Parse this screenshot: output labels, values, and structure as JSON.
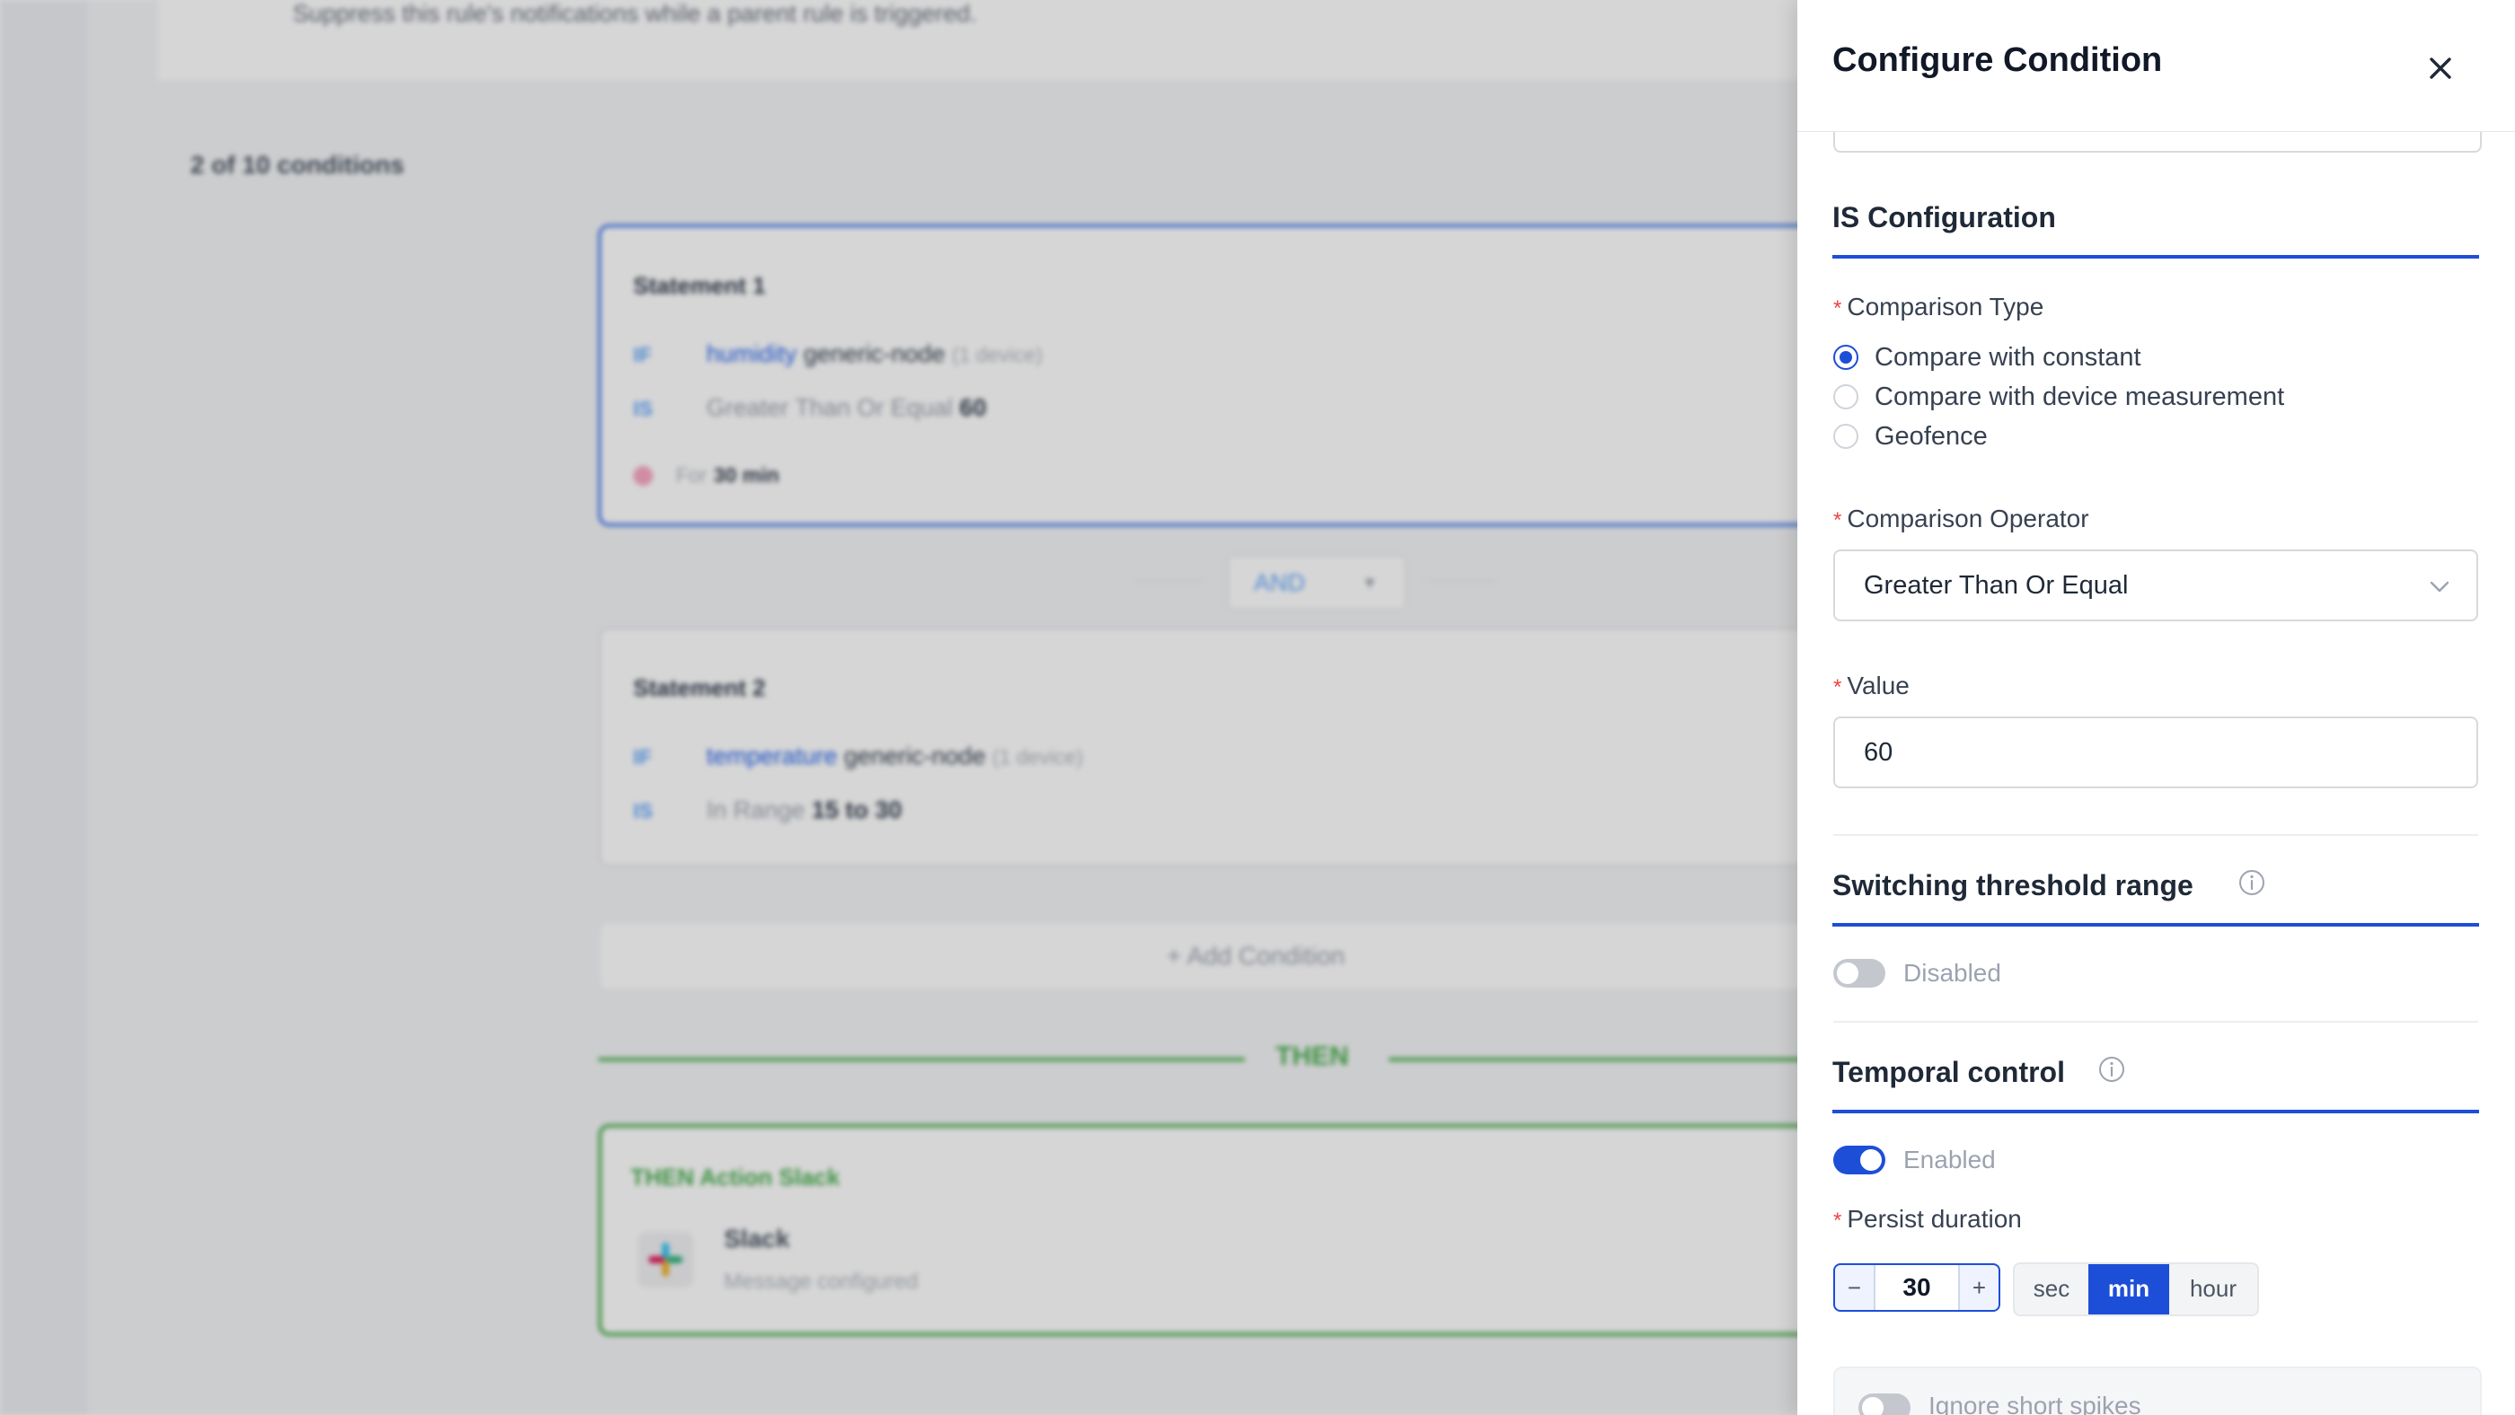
{
  "background": {
    "rule_hint": "Suppress this rule's notifications while a parent rule is triggered.",
    "condition_count": "2 of 10 conditions",
    "statements": [
      {
        "title": "Statement 1",
        "if_kw": "IF",
        "metric": "humidity",
        "node": "generic-node",
        "devices": "(1 device)",
        "is_kw": "IS",
        "operator": "Greater Than Or Equal",
        "value": "60",
        "for_label": "For",
        "for_value": "30 min"
      },
      {
        "title": "Statement 2",
        "if_kw": "IF",
        "metric": "temperature",
        "node": "generic-node",
        "devices": "(1 device)",
        "is_kw": "IS",
        "operator": "In Range",
        "value": "15 to 30"
      }
    ],
    "logic_operator": "AND",
    "add_condition": "+ Add Condition",
    "then_label": "THEN",
    "action": {
      "title": "THEN Action Slack",
      "name": "Slack",
      "status": "Message configured"
    }
  },
  "drawer": {
    "title": "Configure Condition",
    "is_section": "IS Configuration",
    "comparison_type": {
      "label": "Comparison Type",
      "options": [
        "Compare with constant",
        "Compare with device measurement",
        "Geofence"
      ],
      "selected_index": 0
    },
    "operator": {
      "label": "Comparison Operator",
      "value": "Greater Than Or Equal"
    },
    "value_field": {
      "label": "Value",
      "value": "60"
    },
    "switching": {
      "title": "Switching threshold range",
      "state": "Disabled"
    },
    "temporal": {
      "title": "Temporal control",
      "state": "Enabled",
      "persist_label": "Persist duration",
      "duration": "30",
      "minus": "−",
      "plus": "+",
      "units": [
        "sec",
        "min",
        "hour"
      ],
      "selected_unit": "min"
    },
    "spikes": {
      "label": "Ignore short spikes"
    }
  },
  "colors": {
    "accent": "#1d4ed8",
    "required": "#ef4444",
    "then_green": "#4caf50"
  }
}
